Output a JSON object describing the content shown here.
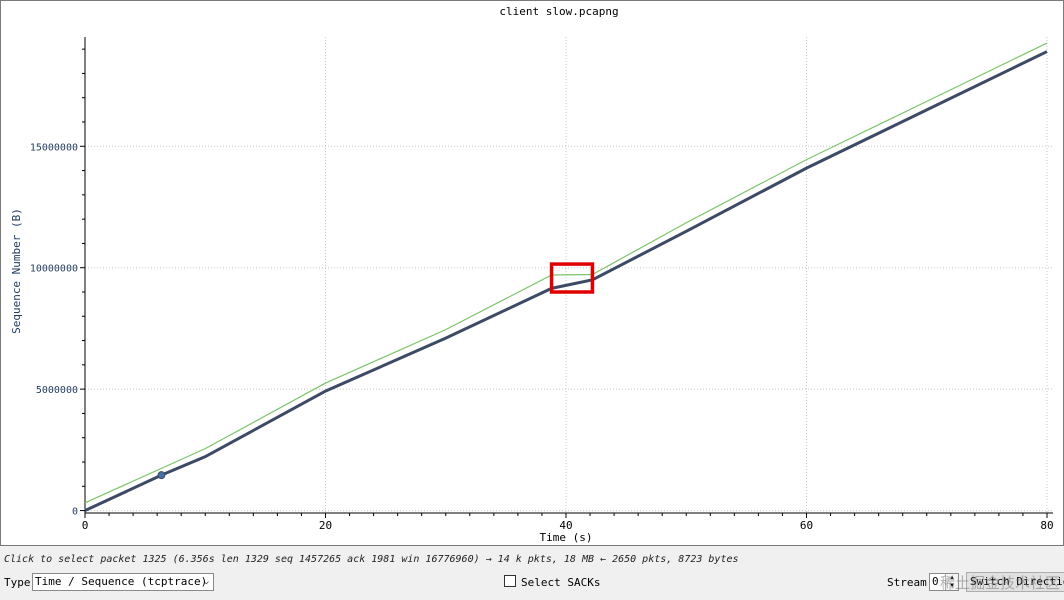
{
  "window": {
    "title": "client slow.pcapng"
  },
  "status": "Click to select packet 1325 (6.356s len 1329 seq 1457265 ack 1981 win 16776960) → 14 k pkts, 18 MB ← 2650 pkts, 8723 bytes",
  "controls": {
    "type_label": "Type",
    "type_value": "Time / Sequence (tcptrace)",
    "select_sacks_label": "Select SACKs",
    "stream_label": "Stream",
    "stream_value": "0",
    "switch_direction_label": "Switch Direction"
  },
  "watermark": "稀土掘金技术社区",
  "colors": {
    "sequence": "#3c4a66",
    "window": "#7cc46a",
    "highlight": "#e00000",
    "grid": "#c8c8c8"
  },
  "chart_data": {
    "type": "line",
    "title": "client slow.pcapng",
    "xlabel": "Time (s)",
    "ylabel": "Sequence Number (B)",
    "xlim": [
      0,
      80.5
    ],
    "ylim": [
      -100000,
      19500000
    ],
    "x_ticks": [
      0,
      20,
      40,
      60,
      80
    ],
    "y_ticks": [
      0,
      5000000,
      10000000,
      15000000
    ],
    "x_tick_labels": [
      "0",
      "20",
      "40",
      "60",
      "80"
    ],
    "y_tick_labels": [
      "0",
      "5000000",
      "10000000",
      "15000000"
    ],
    "grid": true,
    "series": [
      {
        "values_x": [
          0,
          6.356,
          10,
          20,
          30,
          38.8,
          42.2,
          50,
          60,
          70,
          80
        ],
        "values_y": [
          0,
          1457265,
          2220000,
          4920000,
          7100000,
          9150000,
          9500000,
          11500000,
          14100000,
          16500000,
          18900000
        ]
      },
      {
        "values_x": [
          0,
          10,
          20,
          30,
          38.8,
          42.2,
          50,
          60,
          70,
          80
        ],
        "values_y": [
          320000,
          2550000,
          5250000,
          7450000,
          9700000,
          9720000,
          11850000,
          14450000,
          16850000,
          19250000
        ]
      }
    ],
    "highlight": {
      "x": [
        38.8,
        42.2
      ],
      "y": [
        9000000,
        10150000
      ]
    },
    "selected_point": {
      "x": 6.356,
      "y": 1457265
    }
  }
}
